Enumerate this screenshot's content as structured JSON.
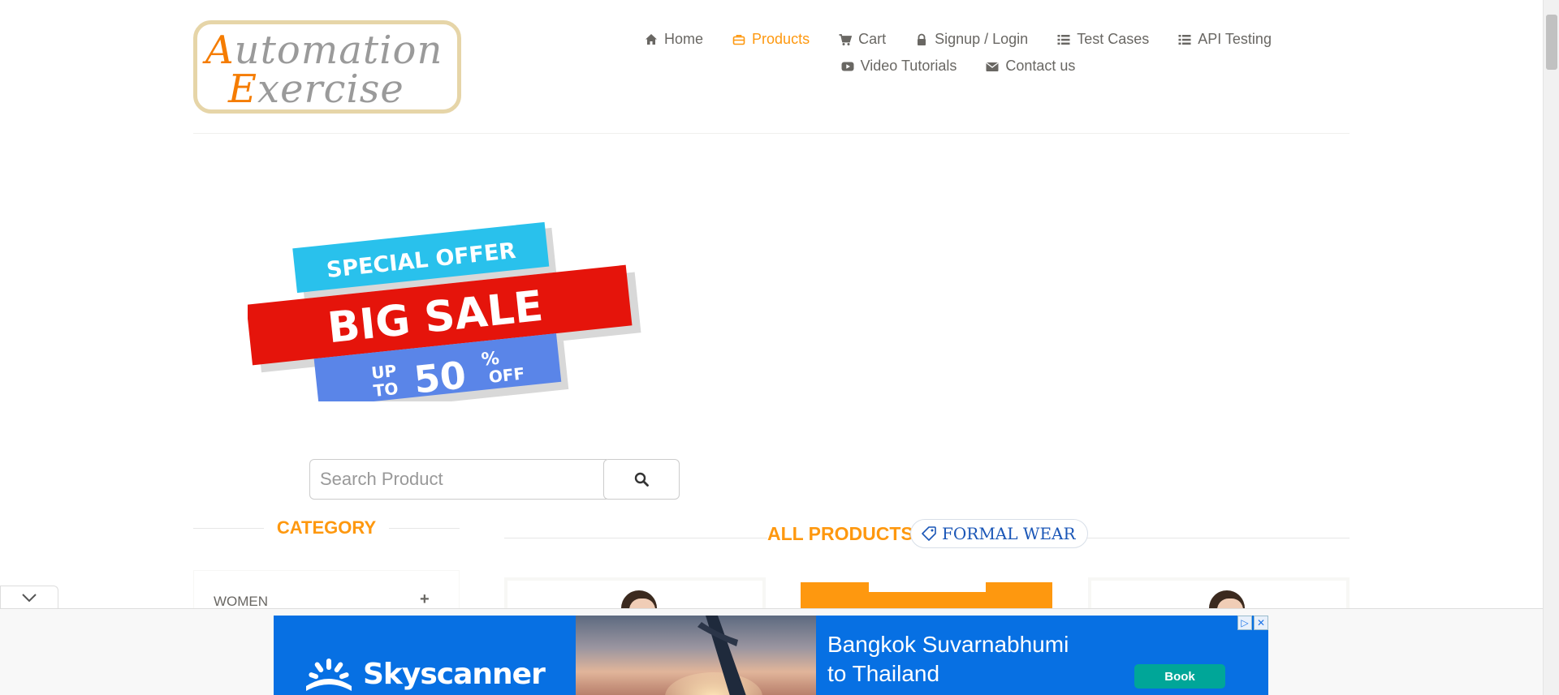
{
  "logo": {
    "line1_cap": "A",
    "line1_rest": "utomation",
    "line2_cap": "E",
    "line2_rest": "xercise"
  },
  "nav": {
    "items": [
      {
        "label": "Home",
        "icon": "home-icon"
      },
      {
        "label": "Products",
        "icon": "briefcase-icon",
        "active": true
      },
      {
        "label": "Cart",
        "icon": "cart-icon"
      },
      {
        "label": "Signup / Login",
        "icon": "lock-icon"
      },
      {
        "label": "Test Cases",
        "icon": "list-icon"
      },
      {
        "label": "API Testing",
        "icon": "list-icon"
      },
      {
        "label": "Video Tutorials",
        "icon": "youtube-play-icon"
      },
      {
        "label": "Contact us",
        "icon": "envelope-icon"
      }
    ]
  },
  "banner": {
    "line1": "SPECIAL OFFER",
    "line2": "BIG SALE",
    "up": "UP",
    "to": "TO",
    "percent": "50",
    "percent_sign": "%",
    "off": "OFF"
  },
  "search": {
    "placeholder": "Search Product",
    "value": ""
  },
  "category": {
    "title": "CATEGORY",
    "items": [
      {
        "label": "WOMEN",
        "toggle": "+"
      }
    ]
  },
  "products": {
    "title": "ALL PRODUCTS",
    "tag": "FORMAL WEAR"
  },
  "ad": {
    "brand": "Skyscanner",
    "headline1": "Bangkok Suvarnabhumi",
    "headline2": "to Thailand",
    "cta": "Book",
    "adchoice_icons": [
      "ad-choices-icon",
      "close-icon"
    ]
  },
  "colors": {
    "accent": "#FE980F",
    "text": "#696763",
    "ad_blue": "#0770e3",
    "ad_cta": "#00a698",
    "tag_text": "#1a56b7"
  }
}
